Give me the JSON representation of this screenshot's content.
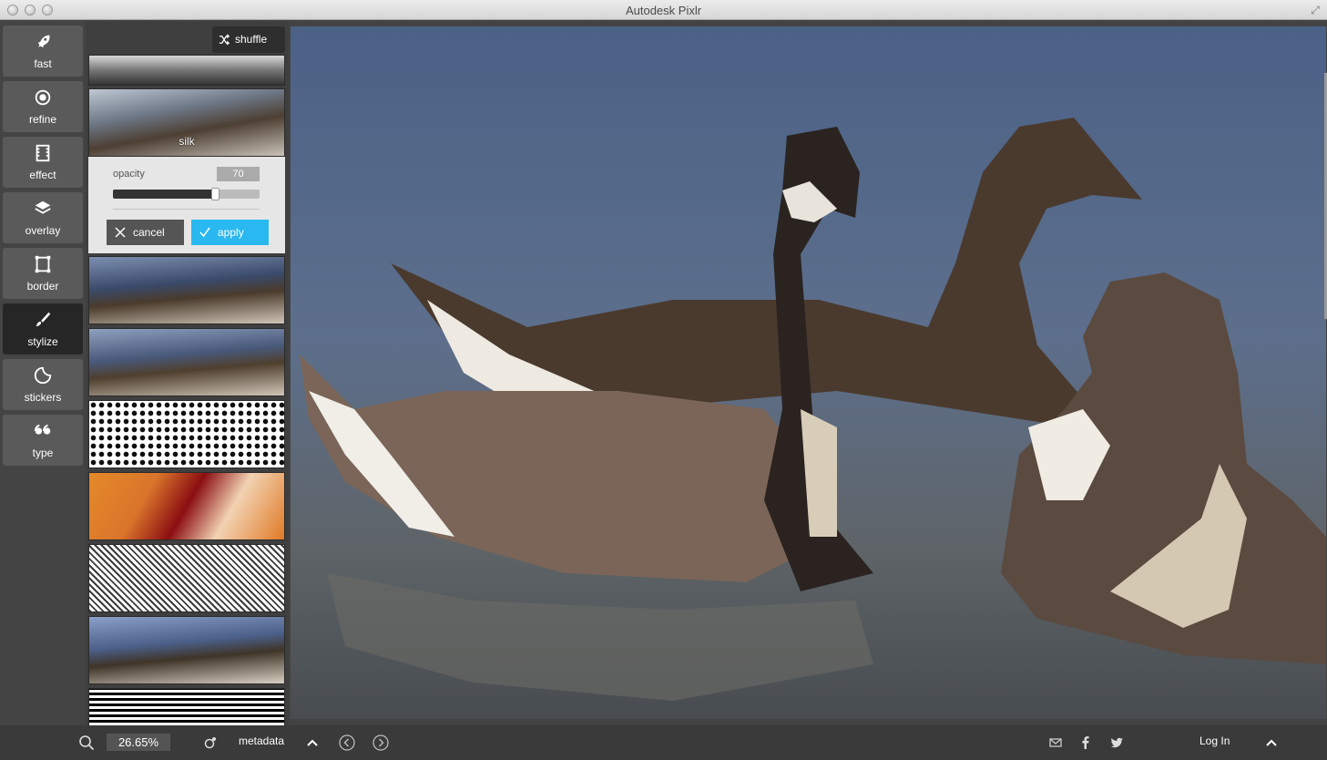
{
  "window": {
    "title": "Autodesk Pixlr"
  },
  "toolbar": {
    "items": [
      {
        "label": "fast",
        "icon": "rocket-icon",
        "active": false
      },
      {
        "label": "refine",
        "icon": "refine-icon",
        "active": false
      },
      {
        "label": "effect",
        "icon": "film-icon",
        "active": false
      },
      {
        "label": "overlay",
        "icon": "layers-icon",
        "active": false
      },
      {
        "label": "border",
        "icon": "border-icon",
        "active": false
      },
      {
        "label": "stylize",
        "icon": "brush-icon",
        "active": true
      },
      {
        "label": "stickers",
        "icon": "sticker-icon",
        "active": false
      },
      {
        "label": "type",
        "icon": "quote-icon",
        "active": false
      }
    ]
  },
  "panel": {
    "shuffle_label": "shuffle",
    "selected_style": "silk",
    "opacity_label": "opacity",
    "opacity_value": "70",
    "opacity_fraction": 0.7,
    "cancel_label": "cancel",
    "apply_label": "apply"
  },
  "statusbar": {
    "zoom": "26.65%",
    "metadata_label": "metadata",
    "login_label": "Log In"
  },
  "colors": {
    "accent": "#29b8ef",
    "active_tool": "#262626"
  }
}
